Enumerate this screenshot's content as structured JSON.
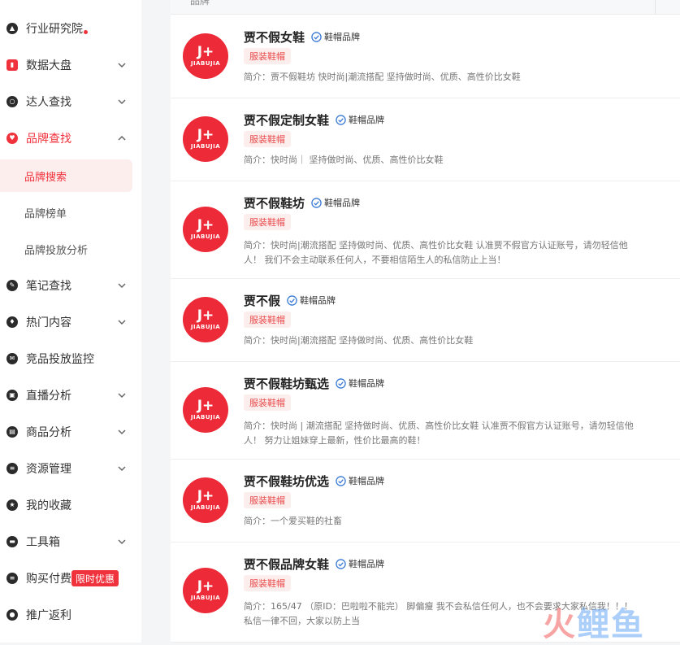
{
  "sidebar": {
    "items": [
      {
        "label": "行业研究院",
        "icon": "graduation-cap-icon",
        "chevron": "none",
        "dot": true
      },
      {
        "label": "数据大盘",
        "icon": "bar-chart-icon",
        "chevron": "down"
      },
      {
        "label": "达人查找",
        "icon": "search-user-icon",
        "chevron": "down"
      },
      {
        "label": "品牌查找",
        "icon": "heart-icon",
        "chevron": "up",
        "active": true
      },
      {
        "label": "笔记查找",
        "icon": "pencil-icon",
        "chevron": "down"
      },
      {
        "label": "热门内容",
        "icon": "flame-icon",
        "chevron": "down"
      },
      {
        "label": "竞品投放监控",
        "icon": "mail-icon",
        "chevron": "none"
      },
      {
        "label": "直播分析",
        "icon": "live-icon",
        "chevron": "down"
      },
      {
        "label": "商品分析",
        "icon": "bag-icon",
        "chevron": "down"
      },
      {
        "label": "资源管理",
        "icon": "list-icon",
        "chevron": "down"
      },
      {
        "label": "我的收藏",
        "icon": "star-icon",
        "chevron": "none"
      },
      {
        "label": "工具箱",
        "icon": "toolbox-icon",
        "chevron": "down"
      },
      {
        "label": "购买付费",
        "icon": "wallet-icon",
        "chevron": "none",
        "badge": "限时优惠"
      },
      {
        "label": "推广返利",
        "icon": "user-icon",
        "chevron": "none"
      }
    ],
    "subitems": [
      {
        "label": "品牌搜索",
        "selected": true
      },
      {
        "label": "品牌榜单"
      },
      {
        "label": "品牌投放分析"
      }
    ],
    "accent_color": "#f0323c"
  },
  "table": {
    "header_label": "品牌",
    "rows": [
      {
        "name": "贾不假女鞋",
        "verify": "鞋帽品牌",
        "tag": "服装鞋帽",
        "desc": "简介：贾不假鞋坊 快时尚|潮流搭配 坚持做时尚、优质、高性价比女鞋",
        "logo_top": "J+",
        "logo_bottom": "JIABUJIA"
      },
      {
        "name": "贾不假定制女鞋",
        "verify": "鞋帽品牌",
        "tag": "服装鞋帽",
        "desc": "简介：快时尚｜ 坚持做时尚、优质、高性价比女鞋",
        "logo_top": "J+",
        "logo_bottom": "JIABUJIA"
      },
      {
        "name": "贾不假鞋坊",
        "verify": "鞋帽品牌",
        "tag": "服装鞋帽",
        "desc": "简介：快时尚|潮流搭配 坚持做时尚、优质、高性价比女鞋 认准贾不假官方认证账号，请勿轻信他人！ 我们不会主动联系任何人，不要相信陌生人的私信防止上当！",
        "logo_top": "J+",
        "logo_bottom": "JIABUJIA"
      },
      {
        "name": "贾不假",
        "verify": "鞋帽品牌",
        "tag": "服装鞋帽",
        "desc": "简介：快时尚|潮流搭配 坚持做时尚、优质、高性价比女鞋",
        "logo_top": "J+",
        "logo_bottom": "JIABUJIA"
      },
      {
        "name": "贾不假鞋坊甄选",
        "verify": "鞋帽品牌",
        "tag": "服装鞋帽",
        "desc": "简介：快时尚 | 潮流搭配 坚持做时尚、优质、高性价比女鞋 认准贾不假官方认证账号，请勿轻信他人！ 努力让姐妹穿上最新，性价比最高的鞋！",
        "logo_top": "J+",
        "logo_bottom": "JIABUJIA"
      },
      {
        "name": "贾不假鞋坊优选",
        "verify": "鞋帽品牌",
        "tag": "服装鞋帽",
        "desc": "简介：一个爱买鞋的社畜",
        "logo_top": "J+",
        "logo_bottom": "JIABUJIA"
      },
      {
        "name": "贾不假品牌女鞋",
        "verify": "鞋帽品牌",
        "tag": "服装鞋帽",
        "desc": "简介：165/47 （原ID：巴啦啦不能完） 脚偏瘦 我不会私信任何人，也不会要求大家私信我！！！ 私信一律不回，大家以防上当",
        "logo_top": "J+",
        "logo_bottom": "JIABUJIA"
      }
    ],
    "brand_color": "#ec2a38",
    "verify_color": "#3a7bd5"
  },
  "watermark": {
    "part_a": "火",
    "part_b": "鲤鱼"
  }
}
